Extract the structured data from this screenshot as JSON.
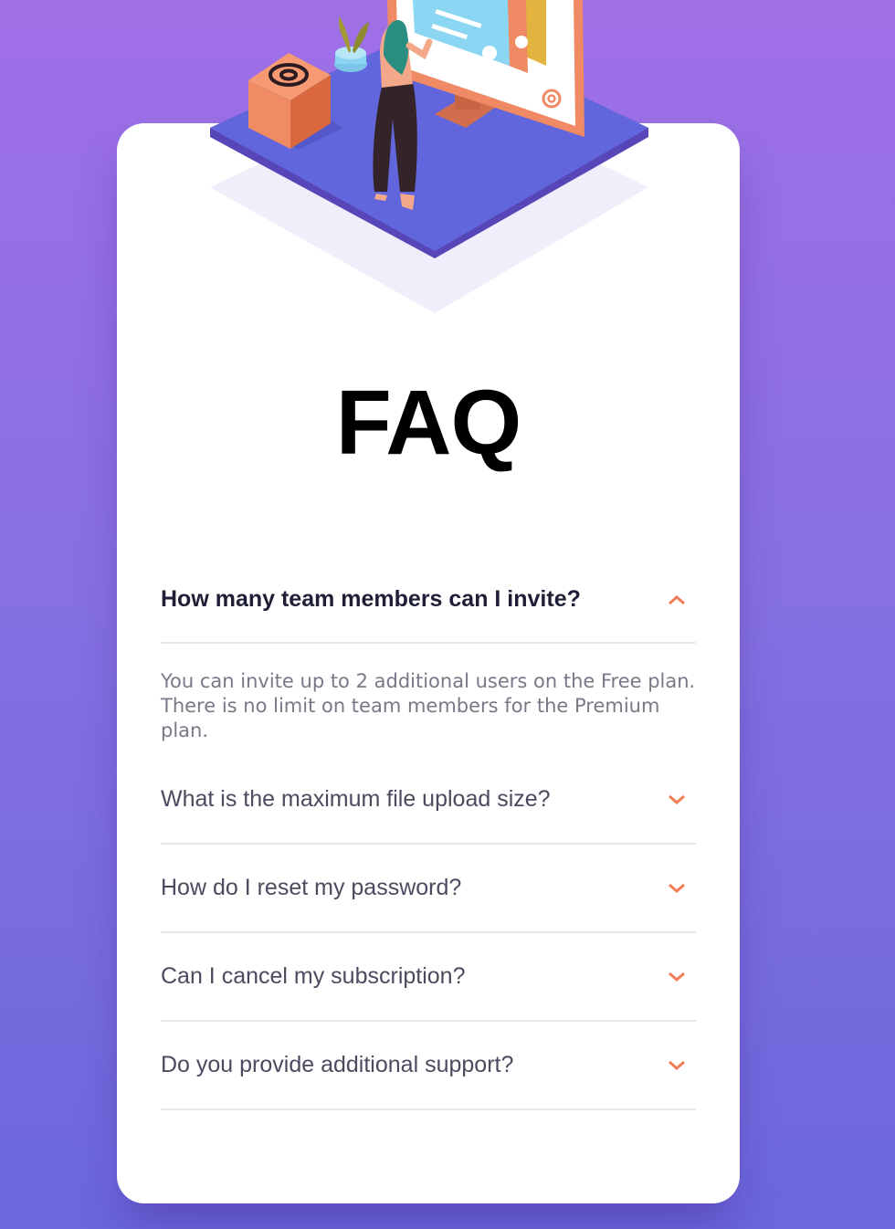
{
  "page": {
    "title": "FAQ",
    "accent_color": "#f47b56",
    "background_gradient": [
      "#a06fe6",
      "#6b67dc"
    ]
  },
  "illustration": {
    "name": "woman-at-online-screen-illustration",
    "box_icon": "at-sign-icon",
    "screen_icon": "at-sign-icon"
  },
  "faq": [
    {
      "question": "How many team members can I invite?",
      "answer": "You can invite up to 2 additional users on the Free plan. There is no limit on team members for the Premium plan.",
      "open": true,
      "icon": "chevron-up-icon"
    },
    {
      "question": "What is the maximum file upload size?",
      "open": false,
      "icon": "chevron-down-icon"
    },
    {
      "question": "How do I reset my password?",
      "open": false,
      "icon": "chevron-down-icon"
    },
    {
      "question": "Can I cancel my subscription?",
      "open": false,
      "icon": "chevron-down-icon"
    },
    {
      "question": "Do you provide additional support?",
      "open": false,
      "icon": "chevron-down-icon"
    }
  ]
}
